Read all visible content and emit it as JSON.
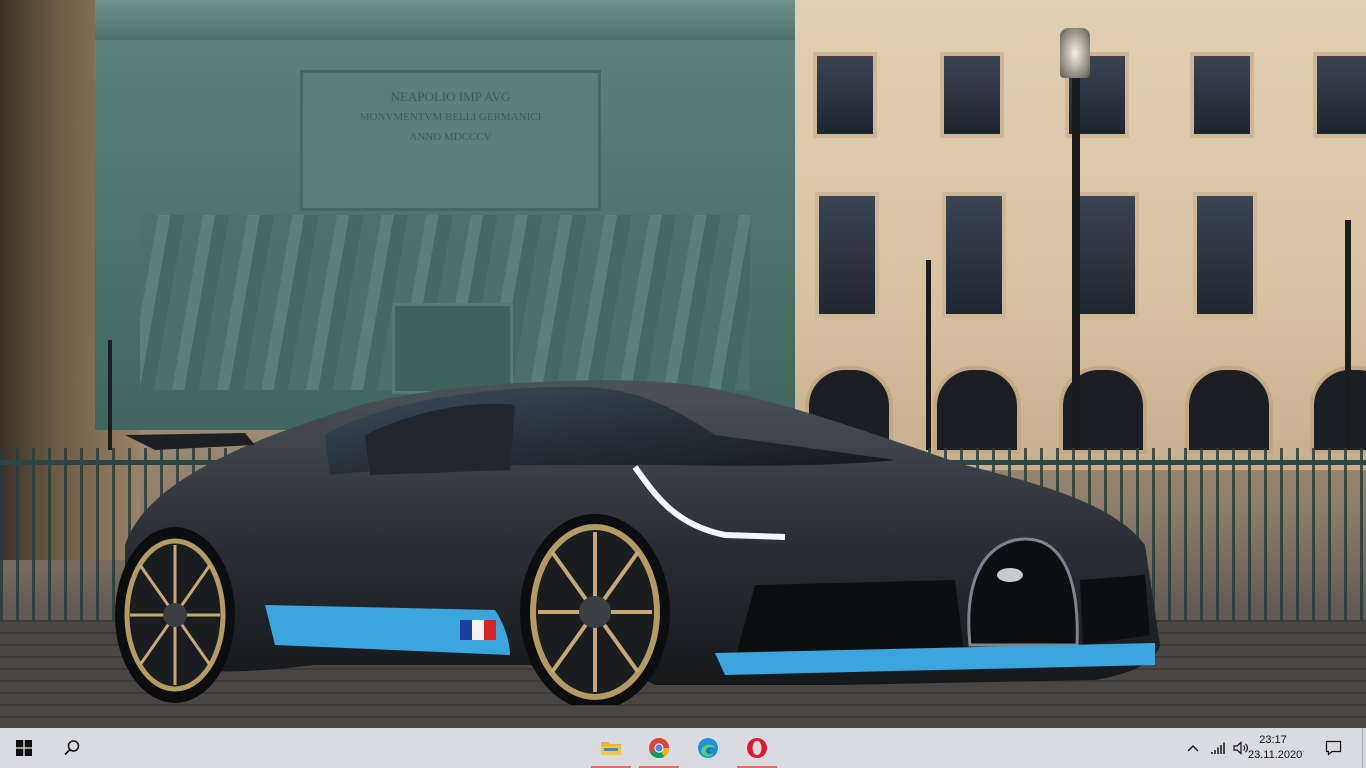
{
  "wallpaper": {
    "subject": "sports-car-wallpaper",
    "monument_inscription_lines": [
      "NEAPOLIO IMP AVG",
      "MONVMENTVM BELLI GERMANICI",
      "ANNO MDCCCV"
    ]
  },
  "taskbar": {
    "start_icon": "windows-logo-icon",
    "search_icon": "search-icon",
    "pinned_apps": [
      {
        "name": "File Explorer",
        "icon": "folder-icon",
        "active": true
      },
      {
        "name": "Google Chrome",
        "icon": "chrome-icon",
        "active": true
      },
      {
        "name": "Microsoft Edge",
        "icon": "edge-icon",
        "active": false
      },
      {
        "name": "Opera",
        "icon": "opera-icon",
        "active": true
      }
    ],
    "tray": {
      "chevron_icon": "chevron-up-icon",
      "network_icon": "wifi-icon",
      "volume_icon": "speaker-icon",
      "time": "23:17",
      "date": "23.11.2020",
      "notification_icon": "notification-icon"
    },
    "colors": {
      "background": "#d9dbe0",
      "active_indicator": "#e86a6a"
    }
  }
}
